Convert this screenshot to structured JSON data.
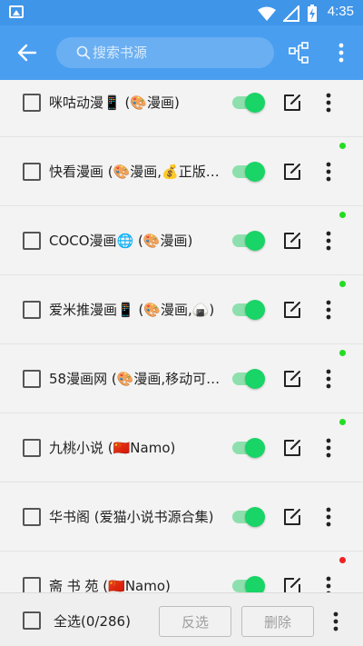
{
  "status_bar": {
    "time": "4:35"
  },
  "toolbar": {
    "search_placeholder": "搜索书源",
    "icons": {
      "back": "arrow-left-icon",
      "sort": "sort-icon",
      "more": "more-vert-icon",
      "search": "search-icon"
    }
  },
  "sources": [
    {
      "name": "咪咕动漫📱 (🎨漫画)",
      "enabled": true,
      "checked": false,
      "status_color": "#22dd22"
    },
    {
      "name": "快看漫画 (🎨漫画,💰正版…",
      "enabled": true,
      "checked": false,
      "status_color": "#22dd22"
    },
    {
      "name": "COCO漫画🌐 (🎨漫画)",
      "enabled": true,
      "checked": false,
      "status_color": "#22dd22"
    },
    {
      "name": "爱米推漫画📱 (🎨漫画,🍙)",
      "enabled": true,
      "checked": false,
      "status_color": "#22dd22"
    },
    {
      "name": "58漫画网 (🎨漫画,移动可…",
      "enabled": true,
      "checked": false,
      "status_color": "#22dd22"
    },
    {
      "name": "九桃小说 (🇨🇳Namo)",
      "enabled": true,
      "checked": false,
      "status_color": "#22dd22"
    },
    {
      "name": "华书阁 (爱猫小说书源合集)",
      "enabled": true,
      "checked": false,
      "status_color": ""
    },
    {
      "name": "斋 书 苑 (🇨🇳Namo)",
      "enabled": true,
      "checked": false,
      "status_color": "#ee2222"
    }
  ],
  "bottom_bar": {
    "select_all_label": "全选(0/286)",
    "invert_label": "反选",
    "delete_label": "删除"
  },
  "colors": {
    "appbar": "#4a9ef0",
    "statusbar": "#3f95e8",
    "toggle_on": "#19d466"
  }
}
